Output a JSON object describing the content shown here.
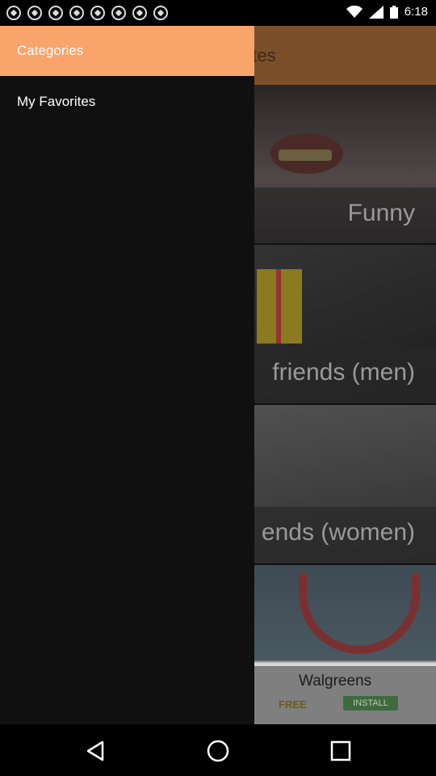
{
  "status_bar": {
    "time": "6:18",
    "notification_icons": [
      "soccer-ball-icon",
      "soccer-ball-icon",
      "soccer-ball-icon",
      "soccer-ball-icon",
      "soccer-ball-icon",
      "soccer-ball-icon",
      "soccer-ball-icon",
      "soccer-ball-icon"
    ]
  },
  "app_bar": {
    "title_partial": "otes"
  },
  "categories": [
    {
      "label": "Funny"
    },
    {
      "label": "friends (men)"
    },
    {
      "label": "ends (women)"
    },
    {
      "label": ""
    }
  ],
  "ad": {
    "name": "Walgreens",
    "price": "FREE",
    "install": "INSTALL"
  },
  "drawer": {
    "header": "Categories",
    "items": [
      {
        "label": "My Favorites"
      }
    ]
  },
  "colors": {
    "drawer_header": "#f9a46a",
    "drawer_bg": "#101010",
    "app_bar": "#7a4f2a"
  },
  "nav_bar": {
    "buttons": [
      "back-icon",
      "home-icon",
      "recents-icon"
    ]
  }
}
